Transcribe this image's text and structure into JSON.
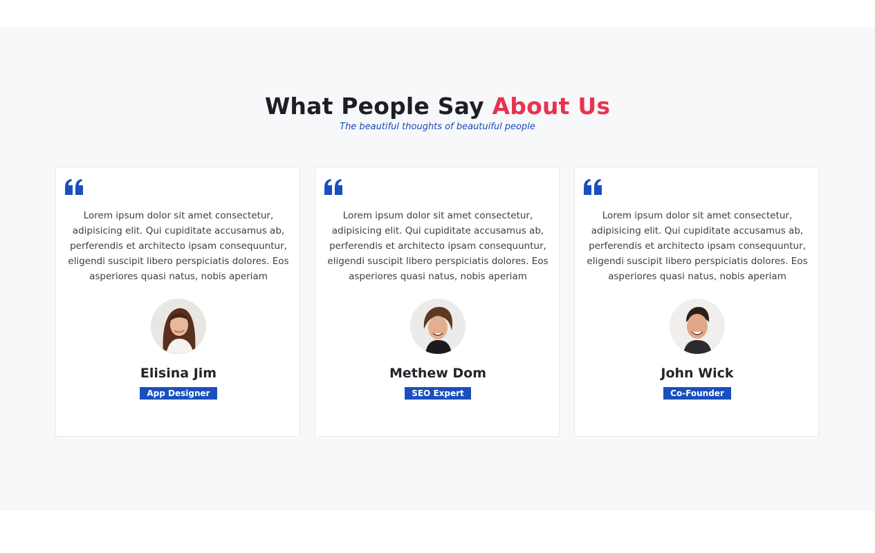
{
  "section": {
    "title_main": "What People Say",
    "title_accent": "About Us",
    "subtitle": "The beautiful thoughts of beautuiful people"
  },
  "colors": {
    "accent": "#e8334f",
    "brand_blue": "#1a4fbf",
    "section_bg": "#f7f8fa"
  },
  "testimonials": [
    {
      "quote": "Lorem ipsum dolor sit amet consectetur, adipisicing elit. Qui cupiditate accusamus ab, perferendis et architecto ipsam consequuntur, eligendi suscipit libero perspiciatis dolores. Eos asperiores quasi natus, nobis aperiam",
      "name": "Elisina Jim",
      "role": "App Designer",
      "icon": "quote-icon"
    },
    {
      "quote": "Lorem ipsum dolor sit amet consectetur, adipisicing elit. Qui cupiditate accusamus ab, perferendis et architecto ipsam consequuntur, eligendi suscipit libero perspiciatis dolores. Eos asperiores quasi natus, nobis aperiam",
      "name": "Methew Dom",
      "role": "SEO Expert",
      "icon": "quote-icon"
    },
    {
      "quote": "Lorem ipsum dolor sit amet consectetur, adipisicing elit. Qui cupiditate accusamus ab, perferendis et architecto ipsam consequuntur, eligendi suscipit libero perspiciatis dolores. Eos asperiores quasi natus, nobis aperiam",
      "name": "John Wick",
      "role": "Co-Founder",
      "icon": "quote-icon"
    }
  ]
}
